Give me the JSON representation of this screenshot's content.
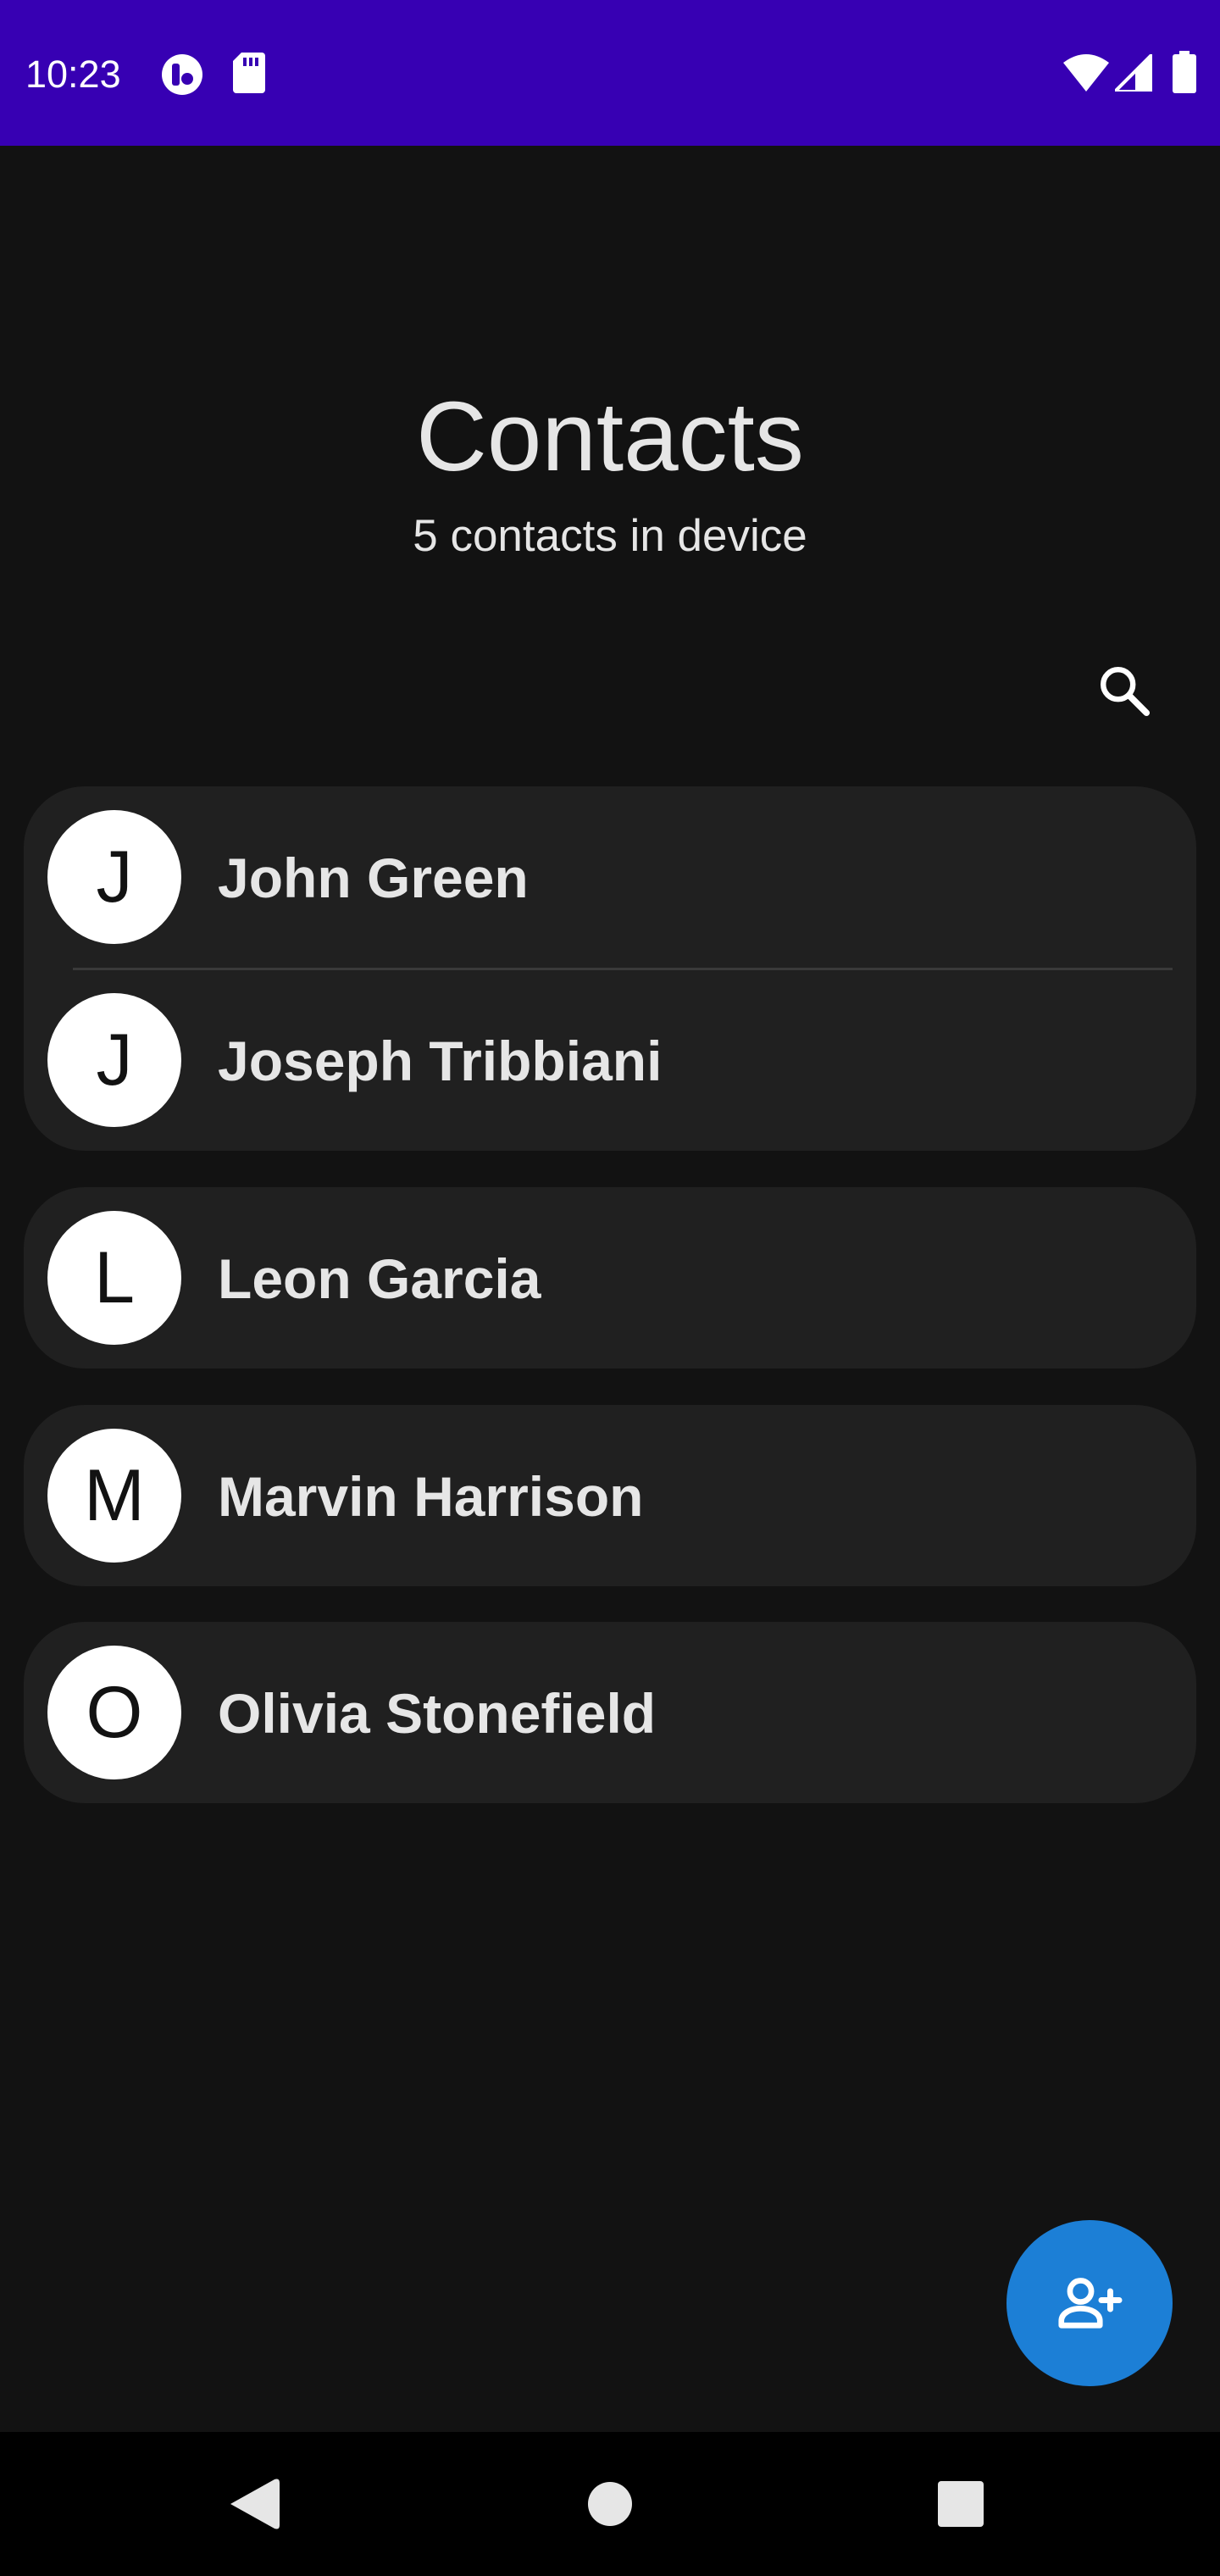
{
  "status_bar": {
    "time": "10:23",
    "icons": [
      "app-notification-icon",
      "sd-card-icon",
      "wifi-icon",
      "cell-signal-icon",
      "battery-icon"
    ],
    "background_color": "#3700b3"
  },
  "header": {
    "title": "Contacts",
    "subtitle": "5 contacts in device"
  },
  "search": {
    "icon": "search-icon"
  },
  "contact_groups": [
    {
      "contacts": [
        {
          "initial": "J",
          "name": "John Green"
        },
        {
          "initial": "J",
          "name": "Joseph Tribbiani"
        }
      ]
    },
    {
      "contacts": [
        {
          "initial": "L",
          "name": "Leon Garcia"
        }
      ]
    },
    {
      "contacts": [
        {
          "initial": "M",
          "name": "Marvin Harrison"
        }
      ]
    },
    {
      "contacts": [
        {
          "initial": "O",
          "name": "Olivia Stonefield"
        }
      ]
    }
  ],
  "fab": {
    "icon": "add-person-icon",
    "color": "#1c7fd6"
  },
  "nav_bar": {
    "icons": [
      "back-icon",
      "home-icon",
      "recents-icon"
    ]
  },
  "colors": {
    "background": "#121212",
    "card": "#202020",
    "text": "#e6e6e6",
    "avatar": "#ffffff"
  }
}
